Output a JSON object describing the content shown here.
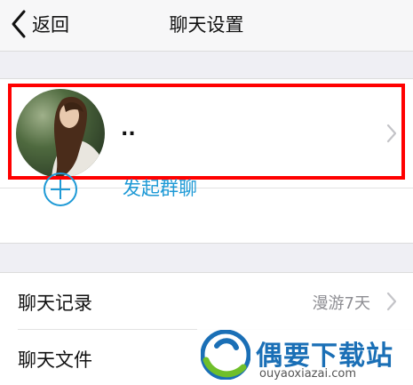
{
  "nav": {
    "back_label": "返回",
    "title": "聊天设置"
  },
  "profile": {
    "name": "..",
    "avatar_desc": "profile photo of a person"
  },
  "group_chat": {
    "label": "发起群聊"
  },
  "settings": {
    "rows": [
      {
        "label": "聊天记录",
        "value": "漫游7天"
      },
      {
        "label": "聊天文件",
        "value": ""
      }
    ]
  },
  "watermark": {
    "title": "偶要下载站",
    "url": "ouyaoxiazai.com"
  },
  "colors": {
    "accent": "#1f9ad6",
    "highlight": "#ff0000",
    "background": "#efeff4"
  }
}
